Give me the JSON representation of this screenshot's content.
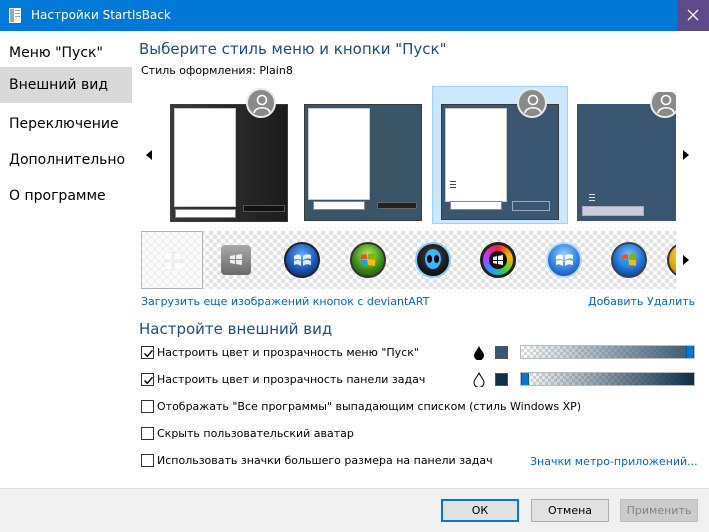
{
  "window": {
    "title": "Настройки StartIsBack"
  },
  "sidebar": {
    "items": [
      {
        "label": "Меню \"Пуск\"",
        "active": false
      },
      {
        "label": "Внешний вид",
        "active": true
      },
      {
        "label": "Переключение",
        "active": false
      },
      {
        "label": "Дополнительно",
        "active": false
      },
      {
        "label": "О программе",
        "active": false
      }
    ]
  },
  "style_section": {
    "heading": "Выберите стиль меню и кнопки \"Пуск\"",
    "style_label": "Стиль оформления:",
    "style_value": "Plain8",
    "selected_thumbnail": 3
  },
  "orbs": {
    "items": [
      "blank-orb",
      "gray-windows-orb",
      "windows-blue-orb",
      "vista-green-orb",
      "alien-orb",
      "rainbow-orb",
      "windows-7-blue-orb",
      "vista-orb",
      "yellow-orb"
    ],
    "selected": 0,
    "download_link": "Загрузить еще изображений кнопок с deviantART",
    "add_link": "Добавить",
    "remove_link": "Удалить"
  },
  "appearance": {
    "heading": "Настройте внешний вид",
    "options": [
      {
        "label": "Настроить цвет и прозрачность меню \"Пуск\"",
        "checked": true
      },
      {
        "label": "Настроить цвет и прозрачность панели задач",
        "checked": true
      },
      {
        "label": "Отображать \"Все программы\" выпадающим списком (стиль Windows XP)",
        "checked": false
      },
      {
        "label": "Скрыть пользовательский аватар",
        "checked": false
      },
      {
        "label": "Использовать значки большего размера на панели задач",
        "checked": false
      }
    ],
    "menu_color": "#3b5670",
    "taskbar_color": "#0e2f4a",
    "menu_opacity": 1.0,
    "taskbar_opacity": 0.0,
    "metro_link": "Значки метро-приложений..."
  },
  "buttons": {
    "ok": "ОК",
    "cancel": "Отмена",
    "apply": "Применить"
  },
  "colors": {
    "titlebar": "#0078d7",
    "heading": "#1e4e79",
    "link": "#0066cc"
  }
}
